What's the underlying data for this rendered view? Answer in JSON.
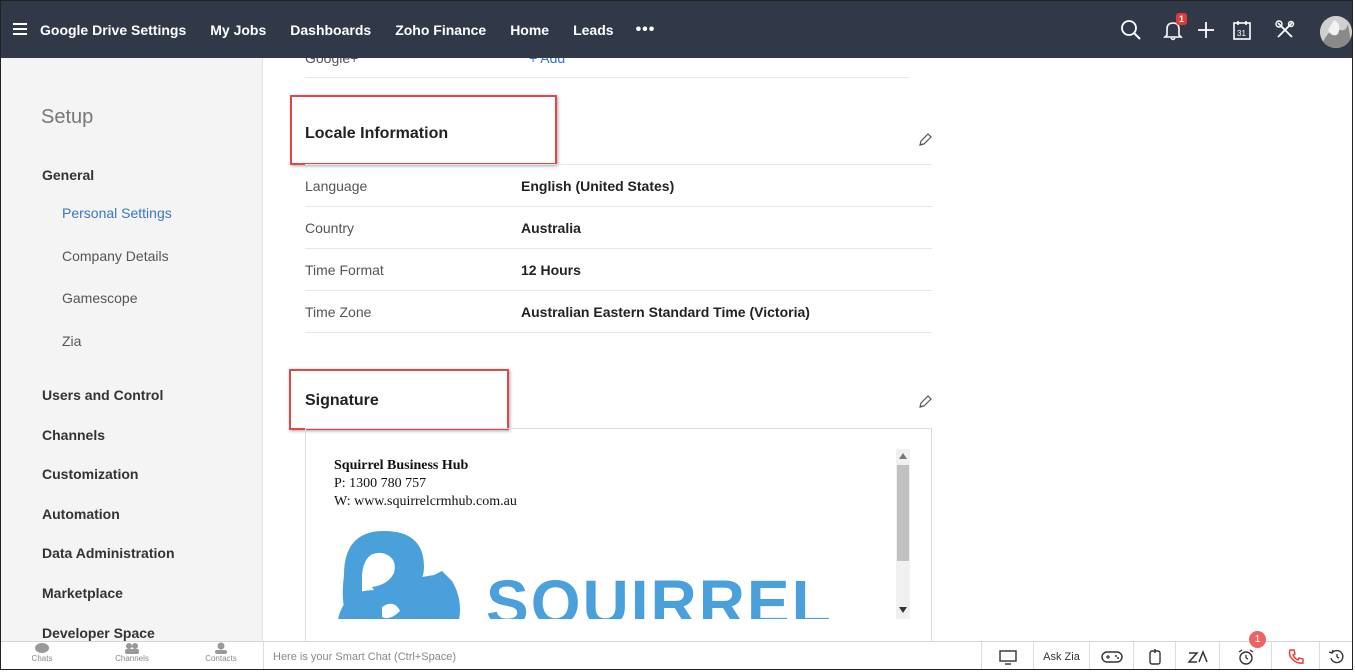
{
  "nav": {
    "items": [
      "Google Drive Settings",
      "My Jobs",
      "Dashboards",
      "Zoho Finance",
      "Home",
      "Leads"
    ],
    "more": "•••",
    "notification_count": "1"
  },
  "sidebar": {
    "title": "Setup",
    "general": "General",
    "subitems": [
      "Personal Settings",
      "Company Details",
      "Gamescope",
      "Zia"
    ],
    "sections": [
      "Users and Control",
      "Channels",
      "Customization",
      "Automation",
      "Data Administration",
      "Marketplace",
      "Developer Space"
    ]
  },
  "partial": {
    "label": "Google+",
    "link": "+ Add"
  },
  "locale": {
    "title": "Locale Information",
    "rows": [
      {
        "k": "Language",
        "v": "English (United States)"
      },
      {
        "k": "Country",
        "v": "Australia"
      },
      {
        "k": "Time Format",
        "v": "12 Hours"
      },
      {
        "k": "Time Zone",
        "v": "Australian Eastern Standard Time (Victoria)"
      }
    ]
  },
  "signature": {
    "title": "Signature",
    "company": "Squirrel Business Hub",
    "phone": "P: 1300 780 757",
    "web": "W: www.squirrelcrmhub.com.au",
    "logo_text": "SQUIRREL",
    "logo_color": "#4aa0db"
  },
  "bottombar": {
    "chats": "Chats",
    "channels": "Channels",
    "contacts": "Contacts",
    "smart_chat_placeholder": "Here is your Smart Chat (Ctrl+Space)",
    "ask_zia": "Ask Zia",
    "alarm_badge": "1"
  },
  "colors": {
    "topbar": "#313949",
    "accent": "#3a76c4",
    "highlight": "#e04848"
  }
}
